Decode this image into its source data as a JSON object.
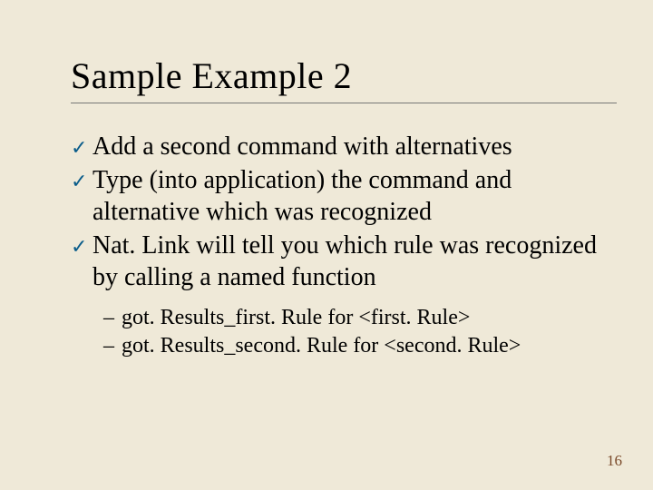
{
  "title": "Sample Example 2",
  "bullets": [
    "Add a second command with alternatives",
    "Type (into application) the command and alternative which was recognized",
    "Nat. Link will tell you which rule was recognized by calling a named function"
  ],
  "sub_bullets": [
    "got. Results_first. Rule for <first. Rule>",
    "got. Results_second. Rule for <second. Rule>"
  ],
  "page_number": "16",
  "check_glyph": "✓",
  "dash_glyph": "–"
}
